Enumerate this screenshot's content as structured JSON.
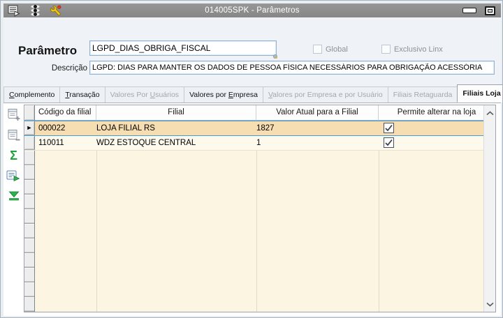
{
  "window": {
    "title": "014005SPK - Parâmetros",
    "titlebar_icons": [
      "form-run-icon",
      "totem-lights-icon",
      "wrench-icon"
    ],
    "window_controls": [
      "minimize",
      "maximize"
    ]
  },
  "form": {
    "parameter_label": "Parâmetro",
    "parameter_value": "LGPD_DIAS_OBRIGA_FISCAL",
    "description_label": "Descrição",
    "description_value": "LGPD: DIAS PARA MANTER OS DADOS DE PESSOA FÍSICA NECESSÁRIOS PARA OBRIGAÇÃO ACESSÓRIA",
    "checkboxes": [
      {
        "label": "Global",
        "checked": false,
        "enabled": false
      },
      {
        "label": "Exclusivo Linx",
        "checked": false,
        "enabled": false
      }
    ]
  },
  "tabs": [
    {
      "label": "Complemento",
      "accel": "C",
      "state": "enabled"
    },
    {
      "label": "Transação",
      "accel": "T",
      "state": "enabled"
    },
    {
      "label": "Valores Por Usuários",
      "accel": "U",
      "state": "disabled"
    },
    {
      "label": "Valores por Empresa",
      "accel": "E",
      "state": "enabled"
    },
    {
      "label": "Valores por Empresa e por Usuário",
      "accel": "V",
      "state": "disabled"
    },
    {
      "label": "Filiais Retaguarda",
      "state": "disabled"
    },
    {
      "label": "Filiais Loja",
      "state": "active"
    }
  ],
  "toolbar": {
    "icons": [
      "add-row-icon",
      "delete-row-icon",
      "sum-icon",
      "post-record-icon",
      "go-to-bottom-icon"
    ]
  },
  "grid": {
    "columns": [
      "Código da filial",
      "Filial",
      "Valor Atual para a Filial",
      "Permite alterar na loja"
    ],
    "rows": [
      {
        "codigo": "000022",
        "filial": "LOJA FILIAL RS",
        "valor": "1827",
        "permite": true,
        "selected": true
      },
      {
        "codigo": "110011",
        "filial": "WDZ ESTOQUE CENTRAL",
        "valor": "1",
        "permite": true,
        "selected": false
      }
    ]
  },
  "colors": {
    "titlebar_bg": "#8C8C8C",
    "selected_row_bg": "#F7DEB2",
    "selected_row_border": "#3F9FD8",
    "grid_row_bg": "#FDFAED",
    "grid_empty_bg": "#FCF5E2",
    "accent_green": "#1EA33C",
    "input_border": "#8FB2D2"
  }
}
